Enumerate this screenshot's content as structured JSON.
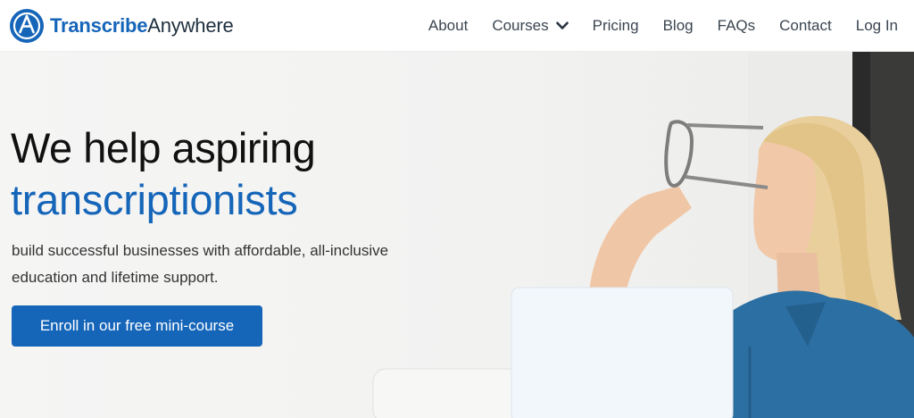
{
  "brand": {
    "name_strong": "Transcribe",
    "name_light": "Anywhere",
    "icon": "transcribe-anywhere-logo-icon",
    "color": "#1565b9"
  },
  "nav": {
    "items": [
      {
        "label": "About"
      },
      {
        "label": "Courses",
        "icon": "chevron-down-icon"
      },
      {
        "label": "Pricing"
      },
      {
        "label": "Blog"
      },
      {
        "label": "FAQs"
      },
      {
        "label": "Contact"
      },
      {
        "label": "Log In"
      }
    ]
  },
  "hero": {
    "headline_line1": "We help aspiring",
    "headline_line2": "transcriptionists",
    "subtext": "build successful businesses with affordable, all-inclusive education and lifetime support.",
    "cta_label": "Enroll in our free mini-course",
    "image": "woman-holding-glasses-with-laptop"
  },
  "colors": {
    "accent": "#1565b9",
    "heading": "#111111",
    "body_text": "#333333",
    "nav_text": "#3b4550"
  }
}
